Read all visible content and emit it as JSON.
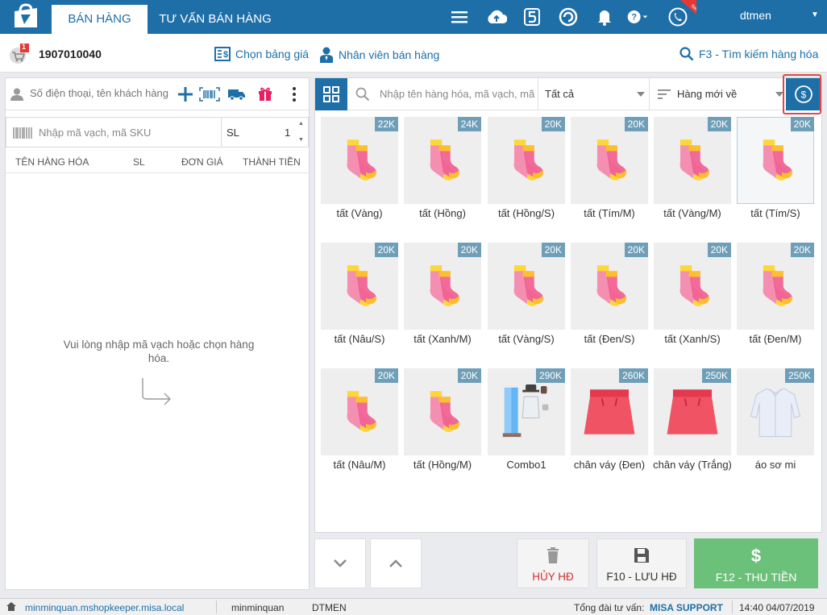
{
  "topbar": {
    "tabs": [
      {
        "label": "BÁN HÀNG",
        "active": true
      },
      {
        "label": "TƯ VẤN BÁN HÀNG",
        "active": false
      }
    ],
    "username": "dtmen",
    "new_badge": "New",
    "icons": [
      "menu-icon",
      "cloud-sync-icon",
      "five-icon",
      "refresh-icon",
      "bell-icon",
      "help-icon",
      "phone-icon"
    ]
  },
  "subheader": {
    "cart_count": "1",
    "invoice_number": "1907010040",
    "price_list_label": "Chọn bảng giá",
    "staff_label": "Nhân viên bán hàng",
    "search_label": "F3 - Tìm kiếm hàng hóa"
  },
  "left": {
    "customer_placeholder": "Số điện thoại, tên khách hàng",
    "barcode_placeholder": "Nhập mã vạch, mã SKU",
    "qty_label": "SL",
    "qty_value": "1",
    "columns": [
      "TÊN HÀNG HÓA",
      "SL",
      "ĐƠN GIÁ",
      "THÀNH TIỀN"
    ],
    "empty_message": "Vui lòng nhập mã vạch hoặc chọn hàng hóa."
  },
  "right": {
    "search_placeholder": "Nhập tên hàng hóa, mã vạch, mã",
    "category_filter": "Tất cả",
    "sort_option": "Hàng mới về",
    "products": [
      {
        "name": "tất (Vàng)",
        "price": "22K",
        "kind": "sock"
      },
      {
        "name": "tất (Hồng)",
        "price": "24K",
        "kind": "sock"
      },
      {
        "name": "tất (Hồng/S)",
        "price": "20K",
        "kind": "sock"
      },
      {
        "name": "tất (Tím/M)",
        "price": "20K",
        "kind": "sock"
      },
      {
        "name": "tất (Vàng/M)",
        "price": "20K",
        "kind": "sock"
      },
      {
        "name": "tất (Tím/S)",
        "price": "20K",
        "kind": "sock"
      },
      {
        "name": "tất (Nâu/S)",
        "price": "20K",
        "kind": "sock"
      },
      {
        "name": "tất (Xanh/M)",
        "price": "20K",
        "kind": "sock"
      },
      {
        "name": "tất (Vàng/S)",
        "price": "20K",
        "kind": "sock"
      },
      {
        "name": "tất (Đen/S)",
        "price": "20K",
        "kind": "sock"
      },
      {
        "name": "tất (Xanh/S)",
        "price": "20K",
        "kind": "sock"
      },
      {
        "name": "tất (Đen/M)",
        "price": "20K",
        "kind": "sock"
      },
      {
        "name": "tất (Nâu/M)",
        "price": "20K",
        "kind": "sock"
      },
      {
        "name": "tất (Hồng/M)",
        "price": "20K",
        "kind": "sock"
      },
      {
        "name": "Combo1",
        "price": "290K",
        "kind": "combo"
      },
      {
        "name": "chân váy (Đen)",
        "price": "260K",
        "kind": "skirt"
      },
      {
        "name": "chân váy (Trắng)",
        "price": "250K",
        "kind": "skirt"
      },
      {
        "name": "áo sơ mi",
        "price": "250K",
        "kind": "shirt"
      }
    ]
  },
  "actions": {
    "cancel_label": "HỦY HĐ",
    "save_label": "F10 - LƯU HĐ",
    "pay_label": "F12 - THU TIỀN",
    "colors": {
      "cancel": "#d32f2f",
      "pay_bg": "#6cc17a",
      "primary": "#1e6fa8"
    }
  },
  "statusbar": {
    "server": "minminquan.mshopkeeper.misa.local",
    "user": "minminquan",
    "store": "DTMEN",
    "hotline_label": "Tổng đài tư vấn:",
    "hotline_value": "MISA SUPPORT",
    "datetime": "14:40 04/07/2019"
  }
}
